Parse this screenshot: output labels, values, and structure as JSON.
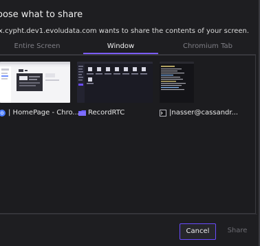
{
  "dialog": {
    "title": "oose what to share",
    "subtitle": "x.cypht.dev1.evoludata.com wants to share the contents of your screen."
  },
  "tabs": [
    {
      "label": "Entire Screen",
      "active": false
    },
    {
      "label": "Window",
      "active": true
    },
    {
      "label": "Chromium Tab",
      "active": false
    }
  ],
  "sources": [
    {
      "label": "| HomePage - Chro...",
      "icon": "chromium-icon"
    },
    {
      "label": "RecordRTC",
      "icon": "folder-icon"
    },
    {
      "label": "|nasser@cassandr...",
      "icon": "terminal-icon"
    }
  ],
  "buttons": {
    "cancel_label": "Cancel",
    "share_label": "Share"
  },
  "colors": {
    "accent": "#7b5cff",
    "background": "#1e1e21"
  }
}
